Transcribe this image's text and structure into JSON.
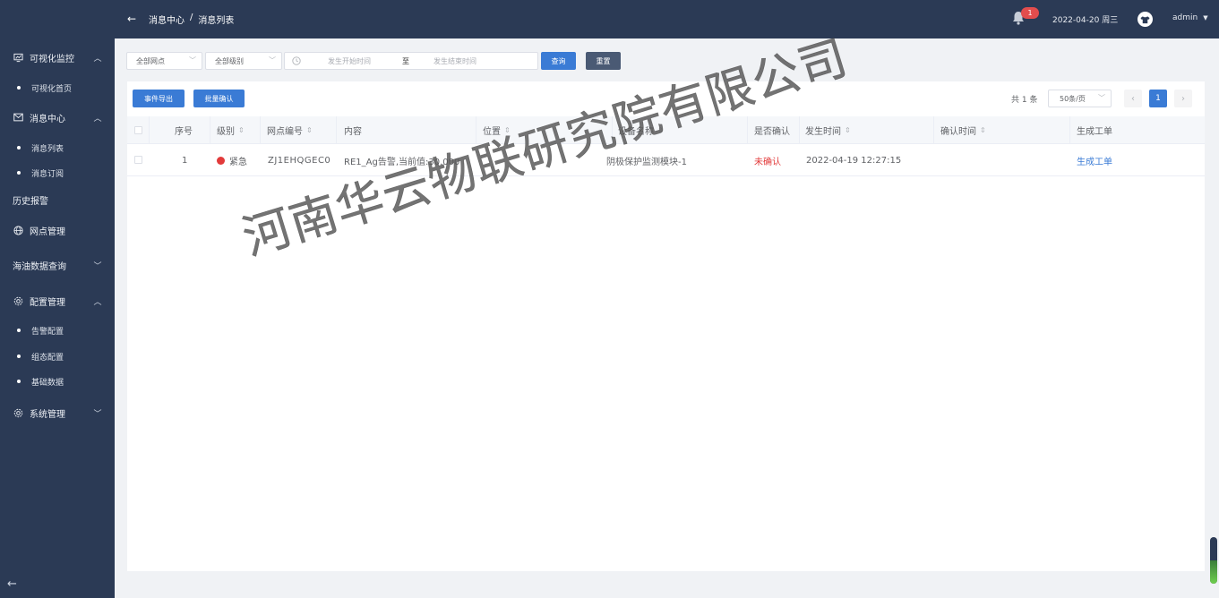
{
  "sidebar": {
    "groups": [
      {
        "label": "可视化监控",
        "icon": "monitor-icon",
        "expanded": true
      },
      {
        "label": "消息中心",
        "icon": "mail-icon",
        "expanded": true
      },
      {
        "label": "历史报警",
        "icon": "",
        "expanded": false
      },
      {
        "label": "网点管理",
        "icon": "globe-icon",
        "expanded": false
      },
      {
        "label": "海油数据查询",
        "icon": "",
        "expanded": false
      },
      {
        "label": "配置管理",
        "icon": "gear-icon",
        "expanded": true
      },
      {
        "label": "系统管理",
        "icon": "gear-icon",
        "expanded": false
      }
    ],
    "sub_items": [
      {
        "label": "可视化首页"
      },
      {
        "label": "消息列表"
      },
      {
        "label": "消息订阅"
      },
      {
        "label": "告警配置"
      },
      {
        "label": "组态配置"
      },
      {
        "label": "基础数据"
      }
    ],
    "collapse_icon": "arrow-left-icon"
  },
  "header": {
    "breadcrumb": [
      "消息中心",
      "/",
      "消息列表"
    ],
    "notification_count": "1",
    "date": "2022-04-20",
    "weekday": "周三",
    "user": "admin"
  },
  "filters": {
    "site": "全部网点",
    "level": "全部级别",
    "start_placeholder": "发生开始时间",
    "range_separator": "至",
    "end_placeholder": "发生结束时间",
    "query_label": "查询",
    "reset_label": "重置"
  },
  "actions": {
    "export_label": "事件导出",
    "batch_confirm_label": "批量确认"
  },
  "pagination": {
    "total": "共 1 条",
    "page_size": "50条/页",
    "current_page": "1",
    "prev_icon": "chevron-left-icon",
    "next_icon": "chevron-right-icon"
  },
  "table": {
    "columns": [
      "序号",
      "级别",
      "网点编号",
      "内容",
      "位置",
      "设备名称",
      "是否确认",
      "发生时间",
      "确认时间",
      "生成工单"
    ],
    "rows": [
      {
        "index": "1",
        "level": "紧急",
        "site_code": "ZJ1EHQGEC0",
        "content": "RE1_Ag告警,当前值:30.000",
        "location": "",
        "device": "阴极保护监测模块-1",
        "confirmed": "未确认",
        "occurred": "2022-04-19 12:27:15",
        "confirmed_time": "",
        "work_order": "生成工单"
      }
    ]
  },
  "watermark": "河南华云物联研究院有限公司",
  "colors": {
    "sidebar_bg": "#2b3a55",
    "primary": "#3a7bd5",
    "danger": "#e23a3a"
  }
}
